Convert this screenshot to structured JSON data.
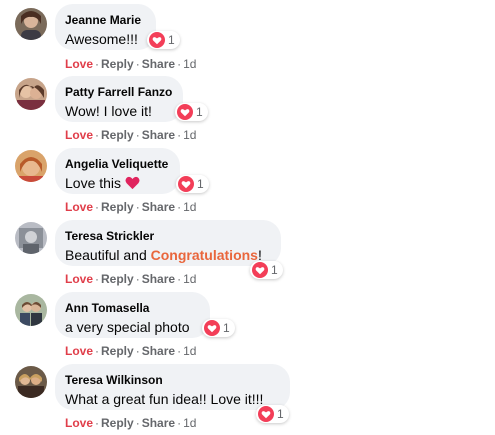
{
  "colors": {
    "bubble_bg": "#f0f2f5",
    "love_action": "#e03e4a",
    "heart_react": "#f33e58",
    "highlight_word": "#e9663c",
    "muted": "#65676b"
  },
  "action_labels": {
    "love": "Love",
    "reply": "Reply",
    "share": "Share"
  },
  "comments": [
    {
      "name": "Jeanne Marie",
      "text": "Awesome!!!",
      "reaction_icon": "heart-icon",
      "reaction_count": "1",
      "time": "1d"
    },
    {
      "name": "Patty Farrell Fanzo",
      "text": "Wow! I love it!",
      "reaction_icon": "heart-icon",
      "reaction_count": "1",
      "time": "1d"
    },
    {
      "name": "Angelia Veliquette",
      "text": "Love this",
      "emoji": "red-heart-emoji",
      "reaction_icon": "heart-icon",
      "reaction_count": "1",
      "time": "1d"
    },
    {
      "name": "Teresa Strickler",
      "text_before": "Beautiful and ",
      "highlight": "Congratulations",
      "text_after": "!",
      "reaction_icon": "heart-icon",
      "reaction_count": "1",
      "time": "1d"
    },
    {
      "name": "Ann Tomasella",
      "text": "a very special photo",
      "reaction_icon": "heart-icon",
      "reaction_count": "1",
      "time": "1d"
    },
    {
      "name": "Teresa Wilkinson",
      "text": "What a great fun idea!! Love it!!!",
      "reaction_icon": "heart-icon",
      "reaction_count": "1",
      "time": "1d"
    }
  ]
}
